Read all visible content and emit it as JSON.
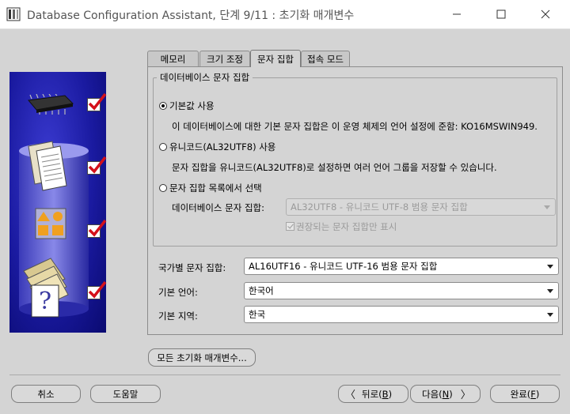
{
  "window": {
    "title": "Database Configuration Assistant, 단계 9/11 : 초기화 매개변수"
  },
  "tabs": [
    {
      "label": "메모리"
    },
    {
      "label": "크기 조정"
    },
    {
      "label": "문자 집합"
    },
    {
      "label": "접속 모드"
    }
  ],
  "charset_group": {
    "title": "데이터베이스 문자 집합",
    "default": {
      "label": "기본값 사용",
      "description": "이 데이터베이스에 대한 기본 문자 집합은 이 운영 체제의 언어 설정에 준함: KO16MSWIN949."
    },
    "unicode": {
      "label": "유니코드(AL32UTF8) 사용",
      "description": "문자 집합을 유니코드(AL32UTF8)로 설정하면 여러 언어 그룹을 저장할 수 있습니다."
    },
    "choose": {
      "label": "문자 집합 목록에서 선택",
      "field_label": "데이터베이스 문자 집합:",
      "field_value": "AL32UTF8 - 유니코드 UTF-8 범용 문자 집합",
      "checkbox_label": "권장되는 문자 집합만 표시"
    }
  },
  "national": {
    "label": "국가별 문자 집합:",
    "value": "AL16UTF16 - 유니코드 UTF-16 범용 문자 집합"
  },
  "language": {
    "label": "기본 언어:",
    "value": "한국어"
  },
  "territory": {
    "label": "기본 지역:",
    "value": "한국"
  },
  "buttons": {
    "all_params": "모든 초기화 매개변수...",
    "cancel": "취소",
    "help": "도움말",
    "back_prefix": "뒤로(",
    "back_key": "B",
    "back_suffix": ")",
    "next_prefix": "다음(",
    "next_key": "N",
    "next_suffix": ")",
    "finish_prefix": "완료(",
    "finish_key": "F",
    "finish_suffix": ")"
  },
  "colors": {
    "panel_blue": "#1a1aa0",
    "check_red": "#d4101a"
  }
}
